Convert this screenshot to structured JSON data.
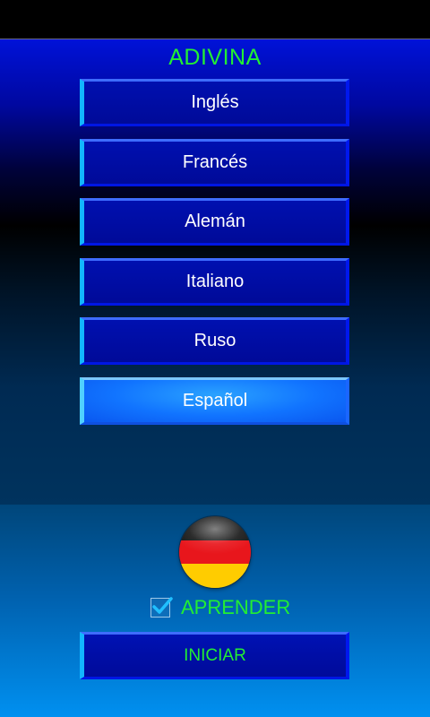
{
  "header": {
    "title": "ADIVINA"
  },
  "languages": [
    {
      "label": "Inglés",
      "selected": false
    },
    {
      "label": "Francés",
      "selected": false
    },
    {
      "label": "Alemán",
      "selected": false
    },
    {
      "label": "Italiano",
      "selected": false
    },
    {
      "label": "Ruso",
      "selected": false
    },
    {
      "label": "Español",
      "selected": true
    }
  ],
  "flag": {
    "icon": "germany-flag-icon",
    "colors": [
      "#1a1a1a",
      "#e8161c",
      "#ffcc00"
    ]
  },
  "learn": {
    "label": "APRENDER",
    "checked": true,
    "icon": "checkmark-icon"
  },
  "start": {
    "label": "INICIAR"
  },
  "colors": {
    "accent_text": "#22ee33",
    "button_face": "#000da4",
    "button_selected": "#1174ff",
    "button_highlight": "#12b6ff"
  }
}
